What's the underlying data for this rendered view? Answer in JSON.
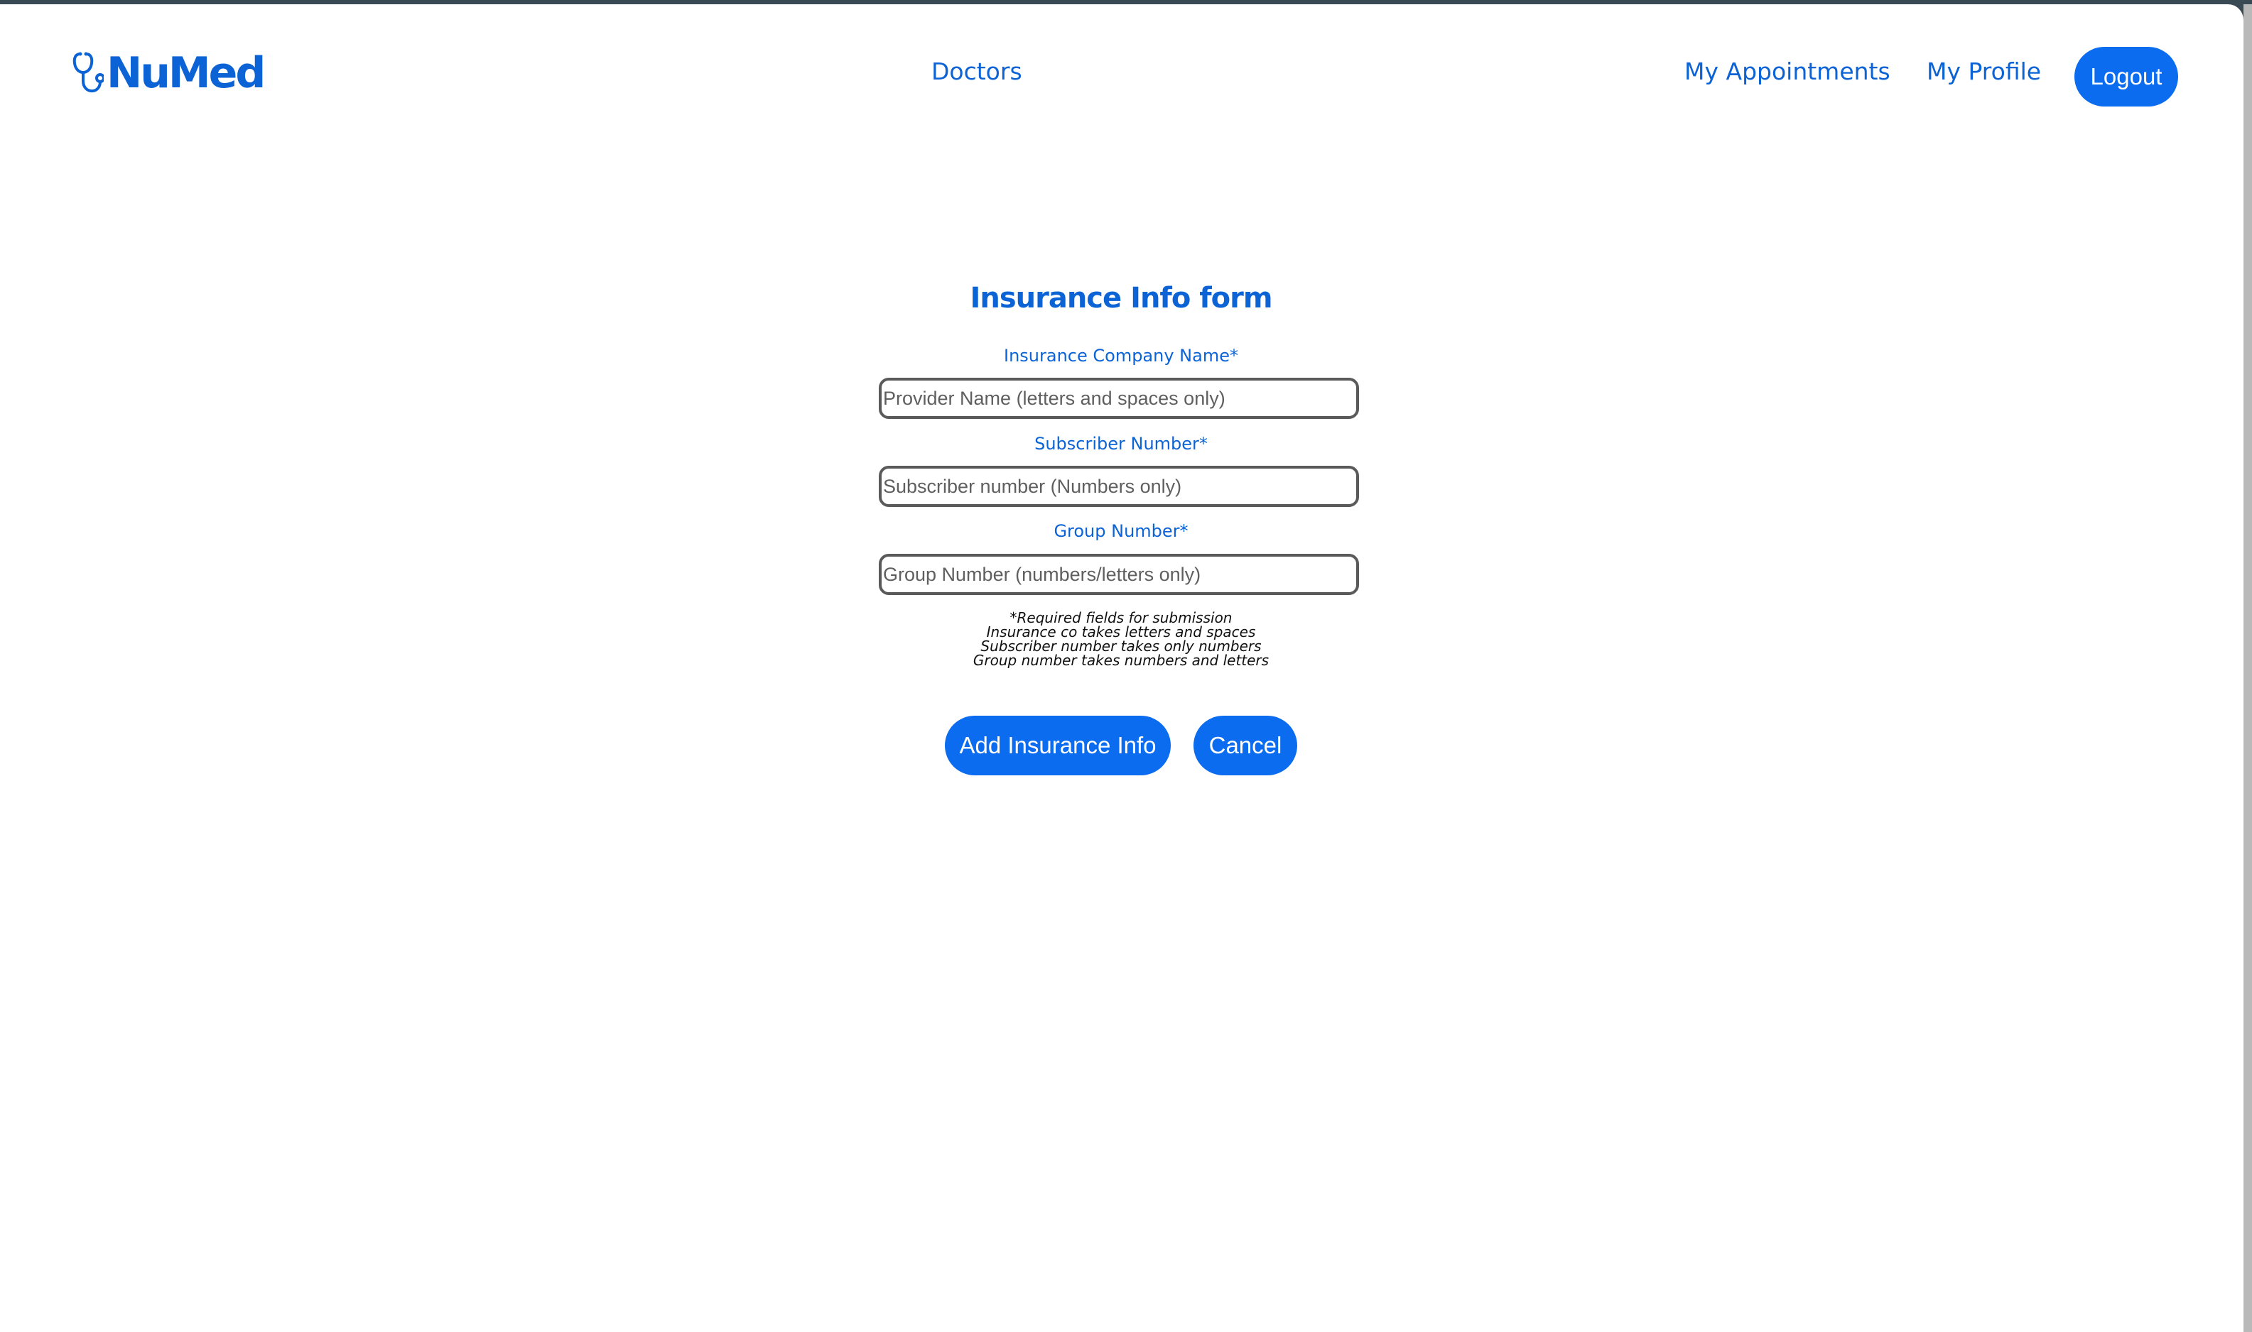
{
  "brand": {
    "name": "NuMed",
    "color": "#0b63d6",
    "button_color": "#0b6cf0"
  },
  "nav": {
    "doctors": "Doctors",
    "my_appointments": "My Appointments",
    "my_profile": "My Profile",
    "logout": "Logout"
  },
  "form": {
    "title": "Insurance Info form",
    "fields": [
      {
        "label": "Insurance Company Name*",
        "placeholder": "Provider Name (letters and spaces only)",
        "value": ""
      },
      {
        "label": "Subscriber Number*",
        "placeholder": "Subscriber number (Numbers only)",
        "value": ""
      },
      {
        "label": "Group Number*",
        "placeholder": "Group Number (numbers/letters only)",
        "value": ""
      }
    ],
    "notes": [
      "*Required fields for submission",
      "Insurance co takes letters and spaces",
      "Subscriber number takes only numbers",
      "Group number takes numbers and letters"
    ],
    "submit_label": "Add Insurance Info",
    "cancel_label": "Cancel"
  },
  "icons": {
    "logo": "stethoscope-icon"
  }
}
